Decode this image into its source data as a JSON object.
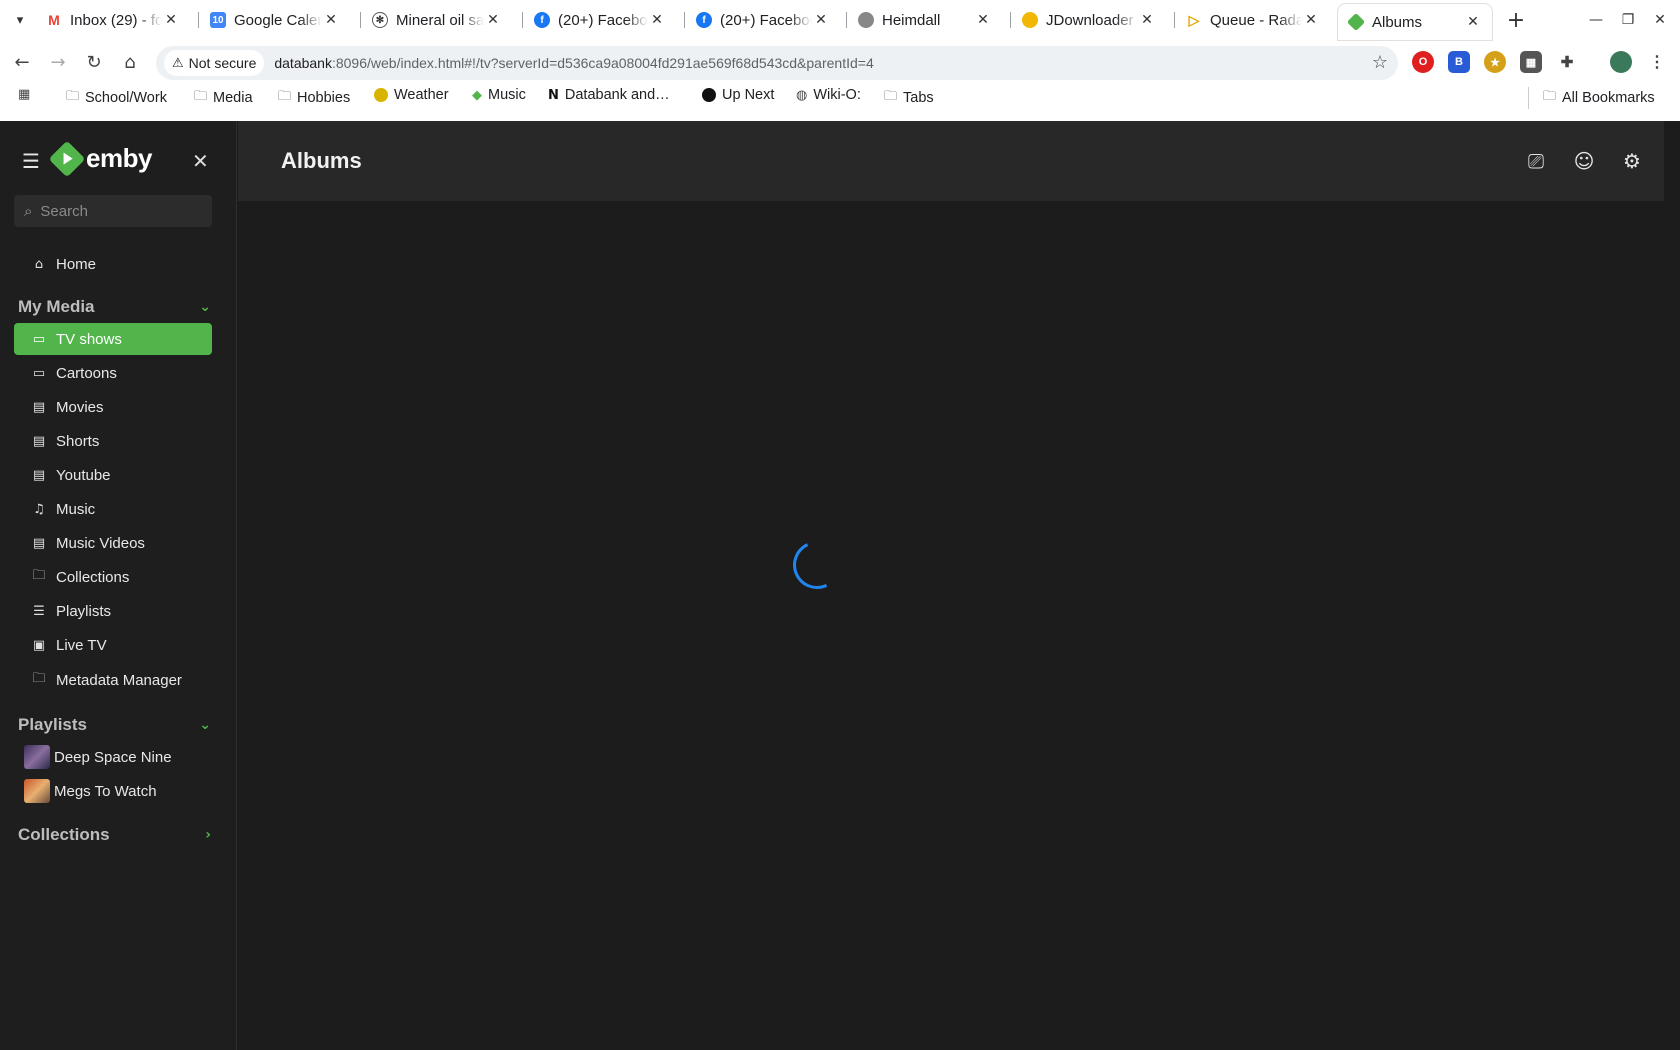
{
  "browser": {
    "tabs": [
      {
        "title": "Inbox (29) - fo",
        "favicon": "gmail-icon"
      },
      {
        "title": "Google Calen",
        "favicon": "calendar-icon"
      },
      {
        "title": "Mineral oil sa",
        "favicon": "openai-icon"
      },
      {
        "title": "(20+) Faceboo",
        "favicon": "facebook-icon"
      },
      {
        "title": "(20+) Faceboo",
        "favicon": "facebook-icon"
      },
      {
        "title": "Heimdall",
        "favicon": "heimdall-icon"
      },
      {
        "title": "JDownloader",
        "favicon": "jdownloader-icon"
      },
      {
        "title": "Queue - Rada",
        "favicon": "radarr-icon"
      },
      {
        "title": "Albums",
        "favicon": "emby-icon",
        "active": true
      }
    ],
    "close_glyph": "✕",
    "security_label": "Not secure",
    "url_host": "databank",
    "url_rest": ":8096/web/index.html#!/tv?serverId=d536ca9a08004fd291ae569f68d543cd&parentId=4",
    "bookmarks": [
      {
        "label": "School/Work",
        "icon": "folder-icon"
      },
      {
        "label": "Media",
        "icon": "folder-icon"
      },
      {
        "label": "Hobbies",
        "icon": "folder-icon"
      },
      {
        "label": "Weather",
        "icon": "weather-icon"
      },
      {
        "label": "Music",
        "icon": "emby-icon"
      },
      {
        "label": "Databank and…",
        "icon": "notion-icon"
      },
      {
        "label": "Up Next",
        "icon": "github-icon"
      },
      {
        "label": "Wiki-O:",
        "icon": "globe-icon"
      },
      {
        "label": "Tabs",
        "icon": "folder-icon"
      }
    ],
    "all_bookmarks": "All Bookmarks"
  },
  "app": {
    "logo_text": "emby",
    "search_placeholder": "Search",
    "home_label": "Home",
    "my_media_heading": "My Media",
    "media_items": [
      {
        "label": "TV shows",
        "icon": "tv-icon",
        "active": true
      },
      {
        "label": "Cartoons",
        "icon": "tv-icon"
      },
      {
        "label": "Movies",
        "icon": "film-icon"
      },
      {
        "label": "Shorts",
        "icon": "film-icon"
      },
      {
        "label": "Youtube",
        "icon": "film-icon"
      },
      {
        "label": "Music",
        "icon": "headphones-icon"
      },
      {
        "label": "Music Videos",
        "icon": "film-icon"
      },
      {
        "label": "Collections",
        "icon": "folder-icon"
      },
      {
        "label": "Playlists",
        "icon": "playlist-icon"
      },
      {
        "label": "Live TV",
        "icon": "livetv-icon"
      },
      {
        "label": "Metadata Manager",
        "icon": "folder-icon"
      }
    ],
    "playlists_heading": "Playlists",
    "playlists": [
      {
        "label": "Deep Space Nine"
      },
      {
        "label": "Megs To Watch"
      }
    ],
    "collections_heading": "Collections",
    "page_title": "Albums",
    "accent": "#52b54b",
    "spinner_color": "#2185f0"
  }
}
